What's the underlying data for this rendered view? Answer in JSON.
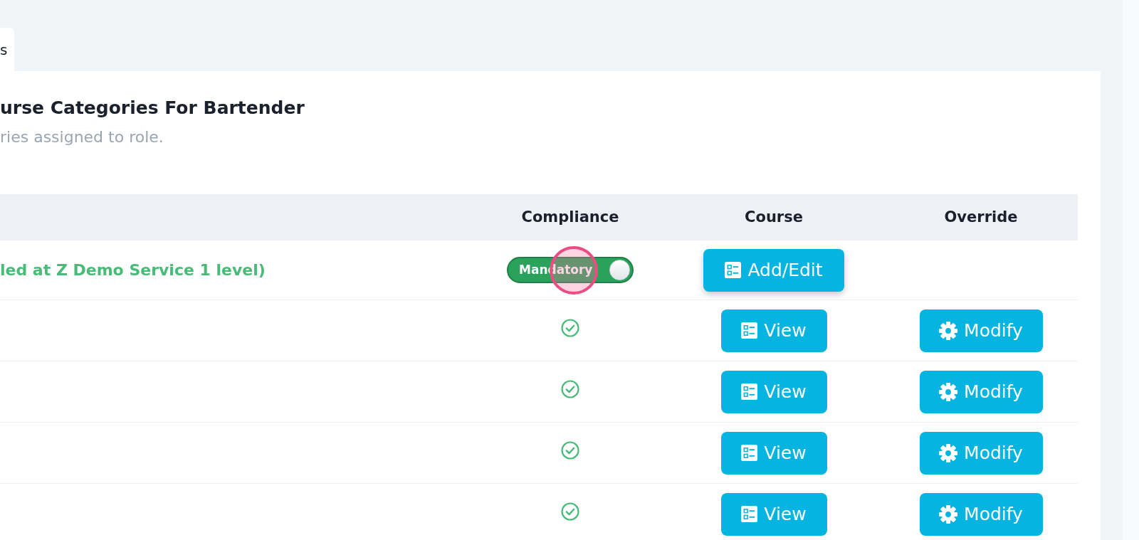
{
  "tabs": [
    {
      "label": "s",
      "selected": true
    }
  ],
  "card": {
    "title": "urse Categories For Bartender",
    "subtitle": "ries assigned to role."
  },
  "table": {
    "columns": [
      "Compliance",
      "Course",
      "Override"
    ],
    "rows": [
      {
        "kind": "group",
        "label": "led at Z Demo Service 1 level)",
        "toggle": {
          "label": "Mandatory",
          "on": true
        },
        "course_button": "Add/Edit"
      },
      {
        "kind": "item",
        "compliant": true,
        "course_button": "View",
        "override_button": "Modify"
      },
      {
        "kind": "item",
        "compliant": true,
        "course_button": "View",
        "override_button": "Modify"
      },
      {
        "kind": "item",
        "compliant": true,
        "course_button": "View",
        "override_button": "Modify"
      },
      {
        "kind": "item",
        "compliant": true,
        "course_button": "View",
        "override_button": "Modify"
      }
    ]
  }
}
